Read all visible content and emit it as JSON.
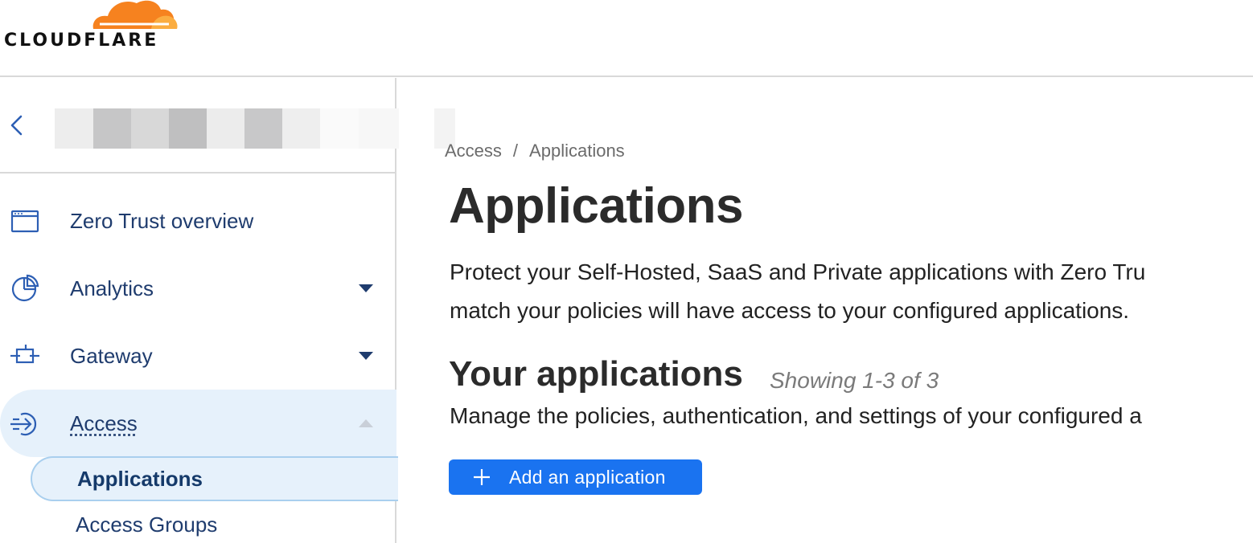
{
  "brand": {
    "logo_text": "CLOUDFLARE",
    "cloud_colors": [
      "#f6821f",
      "#fbad41"
    ]
  },
  "sidebar": {
    "back_icon": "chevron-left-icon",
    "items": [
      {
        "label": "Zero Trust overview",
        "icon": "browser-window-icon",
        "expandable": false
      },
      {
        "label": "Analytics",
        "icon": "pie-chart-icon",
        "expandable": true,
        "expanded": false
      },
      {
        "label": "Gateway",
        "icon": "gateway-icon",
        "expandable": true,
        "expanded": false
      },
      {
        "label": "Access",
        "icon": "access-arrow-icon",
        "expandable": true,
        "expanded": true,
        "active": true
      }
    ],
    "subitems": [
      {
        "label": "Applications",
        "selected": true
      },
      {
        "label": "Access Groups",
        "selected": false
      }
    ]
  },
  "main": {
    "breadcrumb": [
      "Access",
      "Applications"
    ],
    "breadcrumb_separator": "/",
    "title": "Applications",
    "description_line1": "Protect your Self-Hosted, SaaS and Private applications with Zero Tru",
    "description_line2": "match your policies will have access to your configured applications.",
    "section_title": "Your applications",
    "section_count": "Showing 1-3 of 3",
    "section_description": "Manage the policies, authentication, and settings of your configured a",
    "add_button_label": "Add an application"
  },
  "colors": {
    "nav_text": "#1f3c6e",
    "active_bg": "#e6f1fb",
    "primary_button": "#1a73f0",
    "border": "#d9d9d9"
  }
}
